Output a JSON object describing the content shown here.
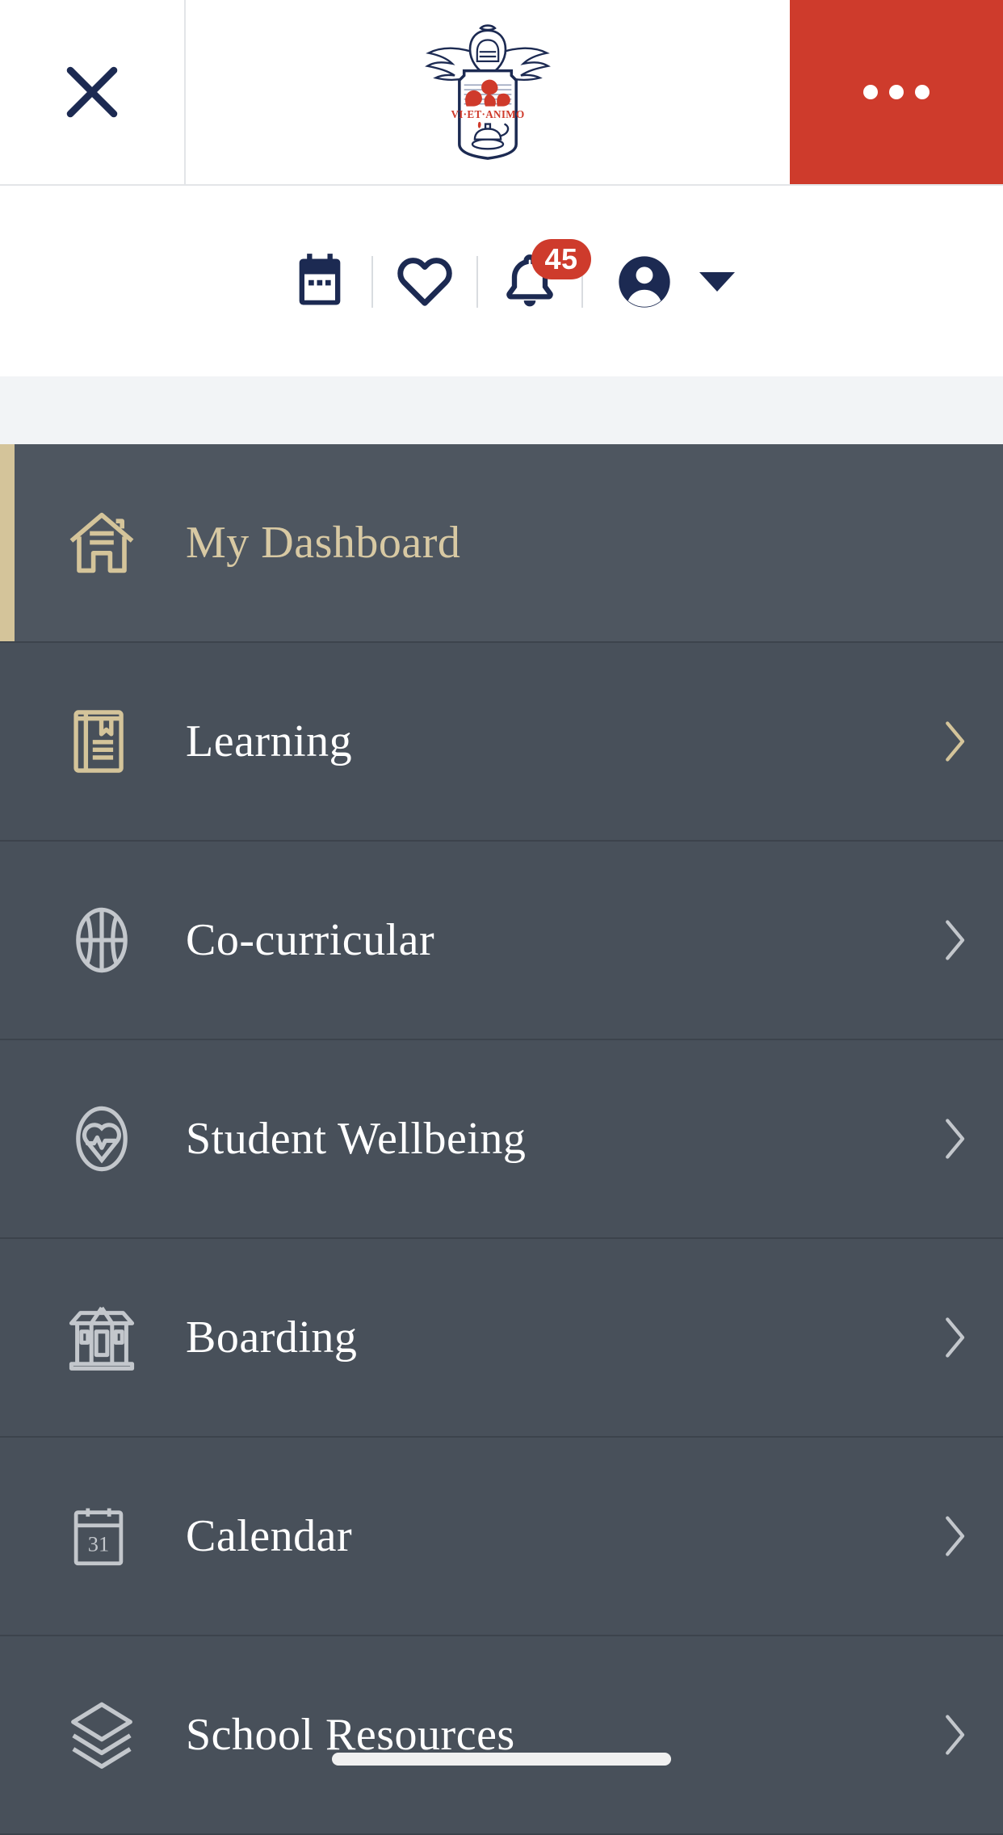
{
  "topbar": {
    "close_icon": "close-x-icon",
    "logo": {
      "name": "school-crest-logo",
      "motto": "VI·ET·ANIMO"
    },
    "more_button": {
      "name": "more-options-button",
      "icon": "three-dots-icon",
      "color": "#ce3b2c"
    }
  },
  "iconbar": {
    "items": [
      {
        "name": "calendar-icon",
        "label": "Calendar"
      },
      {
        "name": "heart-icon",
        "label": "Favourites"
      },
      {
        "name": "bell-icon",
        "label": "Notifications",
        "badge": "45"
      }
    ],
    "account": {
      "avatar_icon": "account-avatar-icon",
      "caret_icon": "chevron-down-icon"
    }
  },
  "menu": {
    "items": [
      {
        "label": "My Dashboard",
        "icon": "home-icon",
        "active": true,
        "chevron": false
      },
      {
        "label": "Learning",
        "icon": "book-icon",
        "active": false,
        "chevron": true,
        "gold_icon": true
      },
      {
        "label": "Co-curricular",
        "icon": "basketball-icon",
        "active": false,
        "chevron": true
      },
      {
        "label": "Student Wellbeing",
        "icon": "heart-pulse-icon",
        "active": false,
        "chevron": true
      },
      {
        "label": "Boarding",
        "icon": "dormitory-icon",
        "active": false,
        "chevron": true
      },
      {
        "label": "Calendar",
        "icon": "calendar-31-icon",
        "active": false,
        "chevron": true
      },
      {
        "label": "School Resources",
        "icon": "layers-icon",
        "active": false,
        "chevron": true
      }
    ]
  },
  "colors": {
    "brand_red": "#ce3b2c",
    "navy": "#1c2a52",
    "panel_dark": "#48505a",
    "accent_gold": "#d4c49a",
    "gray_gap": "#f2f4f6"
  },
  "system": {
    "home_indicator": "home-indicator-bar"
  }
}
